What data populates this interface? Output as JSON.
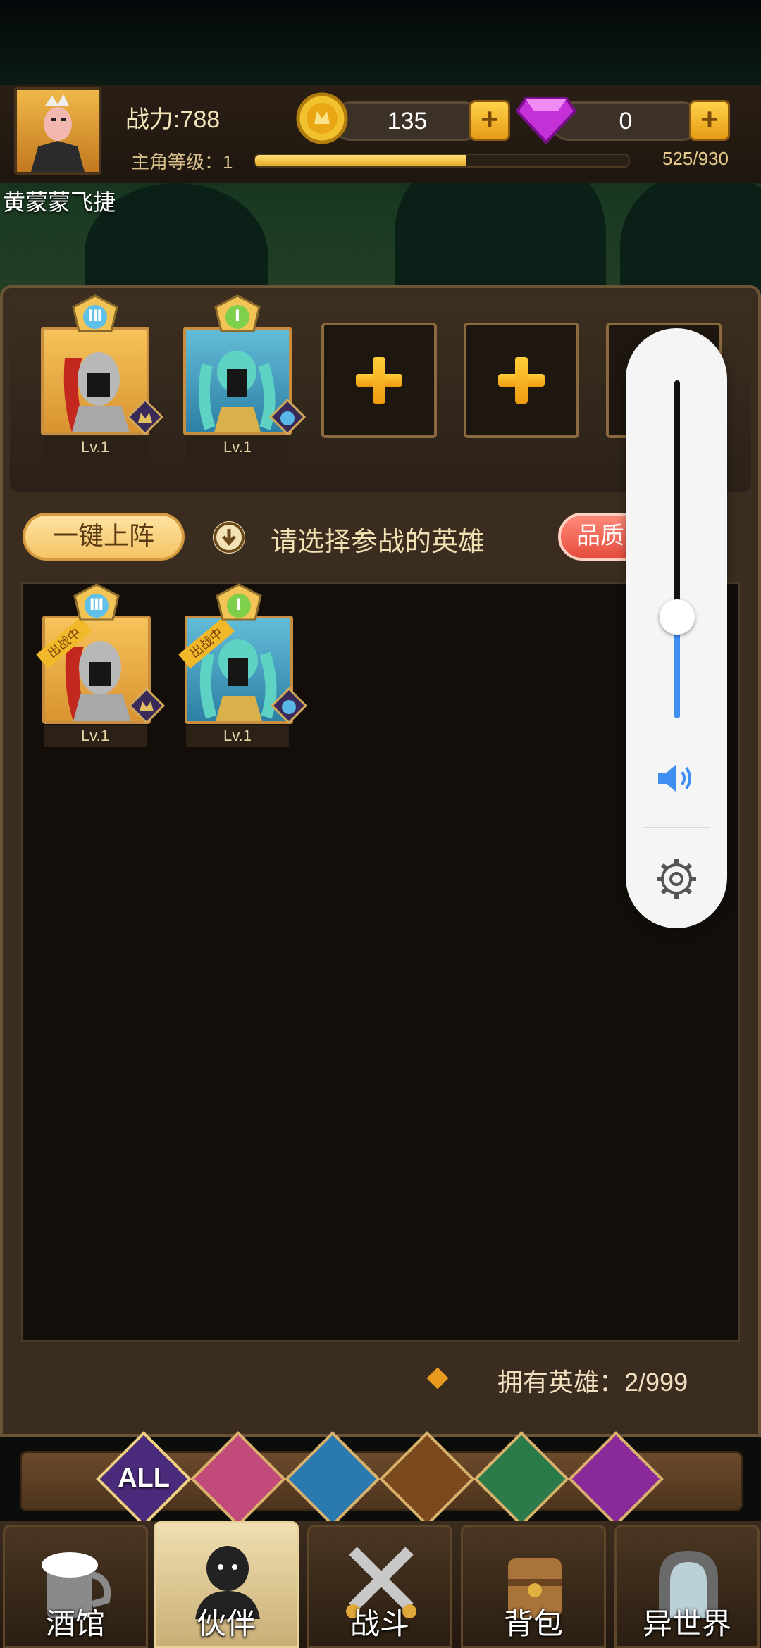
{
  "player": {
    "name": "黄蒙蒙飞捷",
    "power_label": "战力:788",
    "level_label": "主角等级：1",
    "exp_text": "525/930",
    "exp_fraction": 0.565
  },
  "resources": {
    "gold": "135",
    "gems": "0",
    "add": "+"
  },
  "team": {
    "slots": [
      {
        "level": "Lv.1",
        "rank": "Ⅲ",
        "rank_color": "#5fc0e8"
      },
      {
        "level": "Lv.1",
        "rank": "Ⅰ",
        "rank_color": "#7ed04b"
      }
    ]
  },
  "actions": {
    "one_click": "一键上阵",
    "hint": "请选择参战的英雄",
    "quality": "品质"
  },
  "hero_list": {
    "heroes": [
      {
        "level": "Lv.1",
        "rank": "Ⅲ",
        "tag": "出战中"
      },
      {
        "level": "Lv.1",
        "rank": "Ⅰ",
        "tag": "出战中"
      }
    ],
    "owned": "拥有英雄：2/999"
  },
  "filters": {
    "all": "ALL"
  },
  "nav": {
    "tabs": [
      "酒馆",
      "伙伴",
      "战斗",
      "背包",
      "异世界"
    ]
  },
  "volume": {
    "level": 0.3
  },
  "colors": {
    "accent": "#f5c466",
    "quality_button": "#e64d3e",
    "volume_fill": "#3f8ef1"
  }
}
